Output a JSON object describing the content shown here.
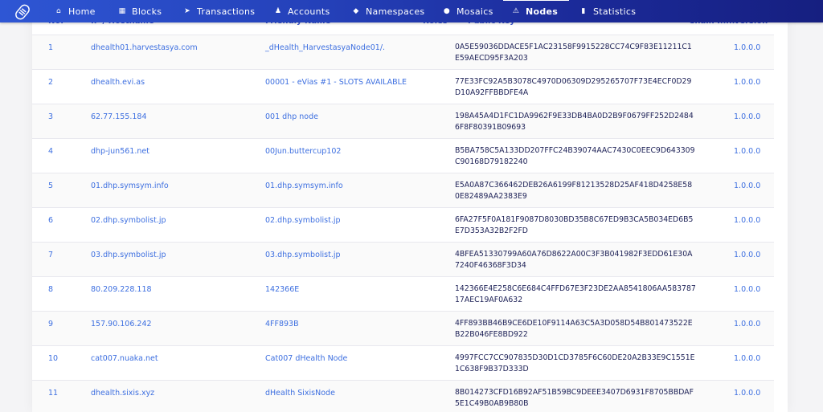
{
  "nav": {
    "items": [
      {
        "label": "Home",
        "icon": "home-icon",
        "glyph": "⌂",
        "active": false
      },
      {
        "label": "Blocks",
        "icon": "blocks-icon",
        "glyph": "▦",
        "active": false
      },
      {
        "label": "Transactions",
        "icon": "transactions-icon",
        "glyph": "➤",
        "active": false
      },
      {
        "label": "Accounts",
        "icon": "accounts-icon",
        "glyph": "♟",
        "active": false
      },
      {
        "label": "Namespaces",
        "icon": "namespaces-icon",
        "glyph": "◆",
        "active": false
      },
      {
        "label": "Mosaics",
        "icon": "mosaics-icon",
        "glyph": "●",
        "active": false
      },
      {
        "label": "Nodes",
        "icon": "nodes-icon",
        "glyph": "⚠",
        "active": true
      },
      {
        "label": "Statistics",
        "icon": "statistics-icon",
        "glyph": "▮",
        "active": false
      }
    ]
  },
  "table": {
    "columns": {
      "no": "No.",
      "host": "IP / Hostname",
      "friendly": "Friendly Name",
      "roles": "Roles",
      "pubkey": "Public Key",
      "chain": "Chain In...",
      "version": "Version"
    },
    "rows": [
      {
        "no": "1",
        "host": "dhealth01.harvestasya.com",
        "friendly": "_dHealth_HarvestasyaNode01/.",
        "pubkey": "0A5E59036DDACE5F1AC23158F9915228CC74C9F83E11211C1E59AECD95F3A203",
        "version": "1.0.0.0"
      },
      {
        "no": "2",
        "host": "dhealth.evi.as",
        "friendly": "00001 - eVias #1 - SLOTS AVAILABLE",
        "pubkey": "77E33FC92A5B3078C4970D06309D295265707F73E4ECF0D29D10A92FFBBDFE4A",
        "version": "1.0.0.0"
      },
      {
        "no": "3",
        "host": "62.77.155.184",
        "friendly": "001 dhp node",
        "pubkey": "198A45A4D1FC1DA9962F9E33DB4BA0D2B9F0679FF252D24846F8F80391B09693",
        "version": "1.0.0.0"
      },
      {
        "no": "4",
        "host": "dhp-jun561.net",
        "friendly": "00Jun.buttercup102",
        "pubkey": "B5BA758C5A133DD207FFC24B39074AAC7430C0EEC9D643309C90168D79182240",
        "version": "1.0.0.0"
      },
      {
        "no": "5",
        "host": "01.dhp.symsym.info",
        "friendly": "01.dhp.symsym.info",
        "pubkey": "E5A0A87C366462DEB26A6199F81213528D25AF418D4258E580E82489AA2383E9",
        "version": "1.0.0.0"
      },
      {
        "no": "6",
        "host": "02.dhp.symbolist.jp",
        "friendly": "02.dhp.symbolist.jp",
        "pubkey": "6FA27F5F0A181F9087D8030BD35B8C67ED9B3CA5B034ED6B5E7D353A32B2F2FD",
        "version": "1.0.0.0"
      },
      {
        "no": "7",
        "host": "03.dhp.symbolist.jp",
        "friendly": "03.dhp.symbolist.jp",
        "pubkey": "4BFEA51330799A60A76D8622A00C3F3B041982F3EDD61E30A7240F46368F3D34",
        "version": "1.0.0.0"
      },
      {
        "no": "8",
        "host": "80.209.228.118",
        "friendly": "142366E",
        "pubkey": "142366E4E258C6E684C4FFD67E3F23DE2AA8541806AA58378717AEC19AF0A632",
        "version": "1.0.0.0"
      },
      {
        "no": "9",
        "host": "157.90.106.242",
        "friendly": "4FF893B",
        "pubkey": "4FF893BB46B9CE6DE10F9114A63C5A3D058D54B801473522EB22B046FE8BD922",
        "version": "1.0.0.0"
      },
      {
        "no": "10",
        "host": "cat007.nuaka.net",
        "friendly": "Cat007 dHealth Node",
        "pubkey": "4997FCC7CC907835D30D1CD3785F6C60DE20A2B33E9C1551E1C638F9B37D333D",
        "version": "1.0.0.0"
      },
      {
        "no": "11",
        "host": "dhealth.sixis.xyz",
        "friendly": "dHealth SixisNode",
        "pubkey": "8B014273CFD16B92AF51B59BC9DEEE3407D6931F8705BBDAF5E1C49B0AB9B80B",
        "version": "1.0.0.0"
      }
    ]
  }
}
